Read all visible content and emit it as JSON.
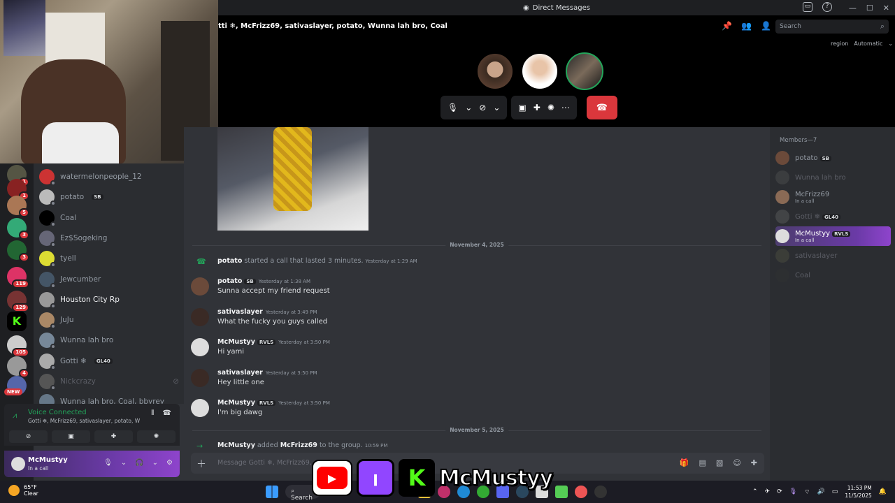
{
  "window": {
    "title": "Direct Messages"
  },
  "call": {
    "heading": "tti ❄, McFrizz69, sativaslayer, potato, Wunna lah bro, Coal",
    "search_placeholder": "Search",
    "region_label": "region",
    "region_value": "Automatic"
  },
  "dm_list": [
    {
      "name": "watermelonpeople_12",
      "tag": "",
      "state": "normal"
    },
    {
      "name": "potato",
      "tag": "SB",
      "state": "normal"
    },
    {
      "name": "Coal",
      "tag": "",
      "state": "normal"
    },
    {
      "name": "Ez$Sogeking",
      "tag": "",
      "state": "normal"
    },
    {
      "name": "tyell",
      "tag": "",
      "state": "normal"
    },
    {
      "name": "Jewcumber",
      "tag": "",
      "state": "normal"
    },
    {
      "name": "Houston City Rp",
      "tag": "",
      "state": "active"
    },
    {
      "name": "JuJu",
      "tag": "",
      "state": "normal"
    },
    {
      "name": "Wunna lah bro",
      "tag": "",
      "state": "normal"
    },
    {
      "name": "Gotti ❄",
      "tag": "GL40",
      "state": "normal"
    },
    {
      "name": "Nickcrazy",
      "tag": "",
      "state": "muted"
    },
    {
      "name": "Wunna lah bro, Coal, bbyrey",
      "tag": "",
      "state": "normal"
    }
  ],
  "server_badges": [
    "1",
    "1",
    "5",
    "3",
    "3",
    "119",
    "129",
    "",
    "105",
    "4",
    ""
  ],
  "new_badge": "NEW",
  "voice": {
    "status": "Voice Connected",
    "channel": "Gotti ❄, McFrizz69, sativaslayer, potato, Wu..."
  },
  "user": {
    "name": "McMustyy",
    "status": "In a call"
  },
  "messages": [
    {
      "kind": "divider",
      "text": "November 4, 2025"
    },
    {
      "kind": "system",
      "user": "potato",
      "text": "started a call that lasted 3 minutes.",
      "time": "Yesterday at 1:29 AM"
    },
    {
      "kind": "msg",
      "user": "potato",
      "tag": "SB",
      "time": "Yesterday at 1:38 AM",
      "body": "Sunna accept my friend request"
    },
    {
      "kind": "msg",
      "user": "sativaslayer",
      "tag": "",
      "time": "Yesterday at 3:49 PM",
      "body": "What the fucky you guys called"
    },
    {
      "kind": "msg",
      "user": "McMustyy",
      "tag": "RVLS",
      "time": "Yesterday at 3:50 PM",
      "body": "Hi yami"
    },
    {
      "kind": "msg",
      "user": "sativaslayer",
      "tag": "",
      "time": "Yesterday at 3:50 PM",
      "body": "Hey little one"
    },
    {
      "kind": "msg",
      "user": "McMustyy",
      "tag": "RVLS",
      "time": "Yesterday at 3:50 PM",
      "body": "I'm big dawg"
    },
    {
      "kind": "divider",
      "text": "November 5, 2025"
    },
    {
      "kind": "system2",
      "user": "McMustyy",
      "text": "added",
      "target": "McFrizz69",
      "rest": "to the group.",
      "time": "10:59 PM"
    }
  ],
  "composer": {
    "placeholder": "Message Gotti ❄, McFrizz69, s..."
  },
  "members": {
    "header": "Members—7",
    "list": [
      {
        "name": "potato",
        "tag": "SB",
        "sub": "",
        "state": "online"
      },
      {
        "name": "Wunna lah bro",
        "tag": "",
        "sub": "",
        "state": "offline"
      },
      {
        "name": "McFrizz69",
        "tag": "",
        "sub": "In a call",
        "state": "online"
      },
      {
        "name": "Gotti ❄",
        "tag": "GL40",
        "sub": "",
        "state": "offline"
      },
      {
        "name": "McMustyy",
        "tag": "RVLS",
        "sub": "In a call",
        "state": "highlight"
      },
      {
        "name": "sativaslayer",
        "tag": "",
        "sub": "",
        "state": "offline"
      },
      {
        "name": "Coal",
        "tag": "",
        "sub": "",
        "state": "offline"
      }
    ]
  },
  "taskbar": {
    "temp": "65°F",
    "weather": "Clear",
    "search": "Search",
    "time": "11:53 PM",
    "date": "11/5/2025"
  },
  "overlay": {
    "channel_name": "McMustyy"
  }
}
